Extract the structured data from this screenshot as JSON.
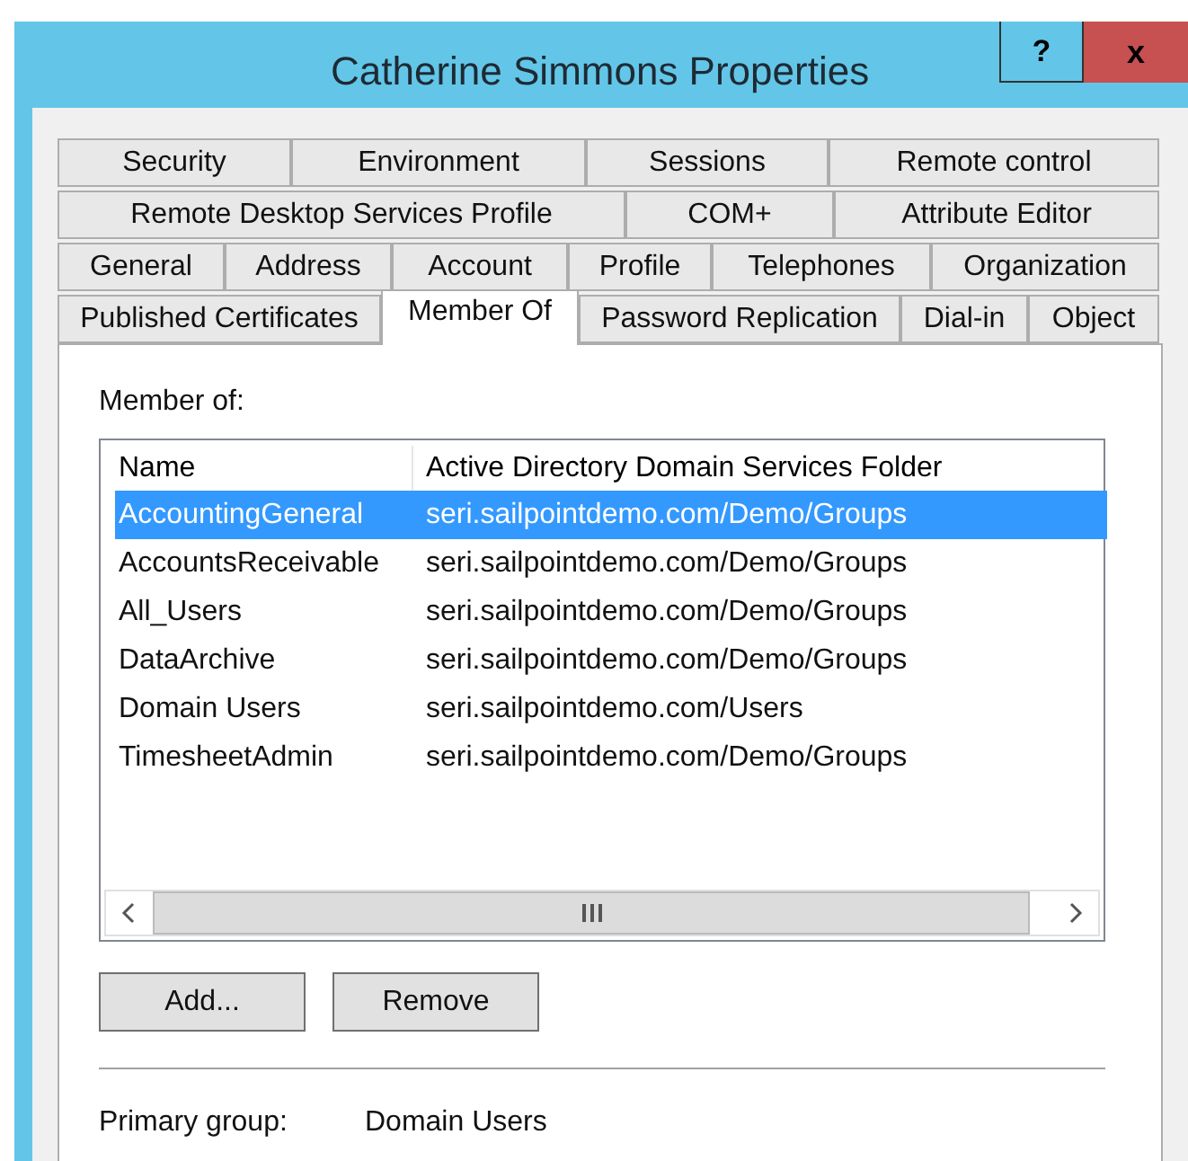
{
  "window": {
    "title": "Catherine Simmons Properties",
    "help": "?",
    "close": "x"
  },
  "tab_rows": [
    [
      {
        "label": "Security",
        "selected": false
      },
      {
        "label": "Environment",
        "selected": false
      },
      {
        "label": "Sessions",
        "selected": false
      },
      {
        "label": "Remote control",
        "selected": false
      }
    ],
    [
      {
        "label": "Remote Desktop Services Profile",
        "selected": false
      },
      {
        "label": "COM+",
        "selected": false
      },
      {
        "label": "Attribute Editor",
        "selected": false
      }
    ],
    [
      {
        "label": "General",
        "selected": false
      },
      {
        "label": "Address",
        "selected": false
      },
      {
        "label": "Account",
        "selected": false
      },
      {
        "label": "Profile",
        "selected": false
      },
      {
        "label": "Telephones",
        "selected": false
      },
      {
        "label": "Organization",
        "selected": false
      }
    ],
    [
      {
        "label": "Published Certificates",
        "selected": false
      },
      {
        "label": "Member Of",
        "selected": true
      },
      {
        "label": "Password Replication",
        "selected": false
      },
      {
        "label": "Dial-in",
        "selected": false
      },
      {
        "label": "Object",
        "selected": false
      }
    ]
  ],
  "member_of": {
    "label": "Member of:",
    "columns": [
      "Name",
      "Active Directory Domain Services Folder"
    ],
    "rows": [
      {
        "name": "AccountingGeneral",
        "folder": "seri.sailpointdemo.com/Demo/Groups",
        "selected": true
      },
      {
        "name": "AccountsReceivable",
        "folder": "seri.sailpointdemo.com/Demo/Groups",
        "selected": false
      },
      {
        "name": "All_Users",
        "folder": "seri.sailpointdemo.com/Demo/Groups",
        "selected": false
      },
      {
        "name": "DataArchive",
        "folder": "seri.sailpointdemo.com/Demo/Groups",
        "selected": false
      },
      {
        "name": "Domain Users",
        "folder": "seri.sailpointdemo.com/Users",
        "selected": false
      },
      {
        "name": "TimesheetAdmin",
        "folder": "seri.sailpointdemo.com/Demo/Groups",
        "selected": false
      }
    ]
  },
  "buttons": [
    "Add...",
    "Remove"
  ],
  "primary_group": {
    "label": "Primary group:",
    "value": "Domain Users"
  }
}
